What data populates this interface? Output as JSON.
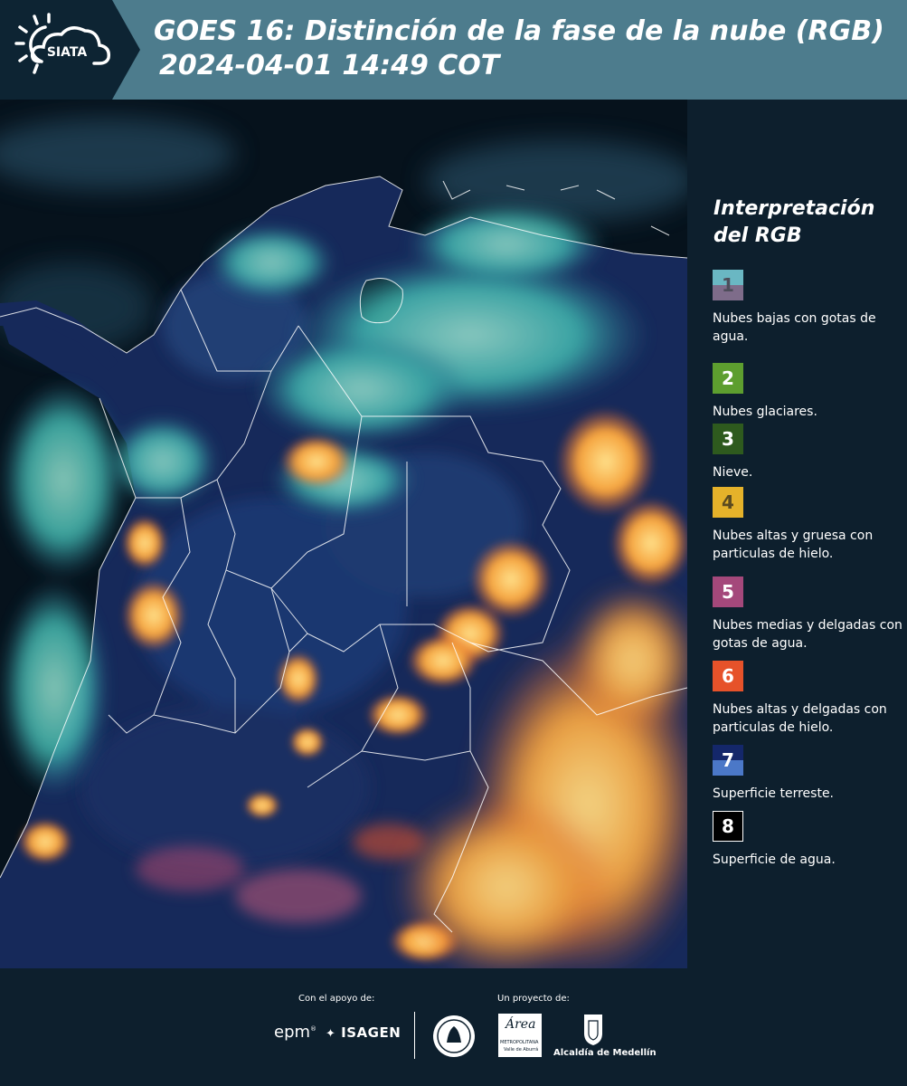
{
  "header": {
    "logo_text": "SIATA",
    "title": "GOES 16: Distinción de la fase de la nube (RGB)",
    "subtitle": "2024-04-01 14:49 COT"
  },
  "legend": {
    "title_line1": "Interpretación",
    "title_line2": "del RGB",
    "items": [
      {
        "number": "1",
        "label": "Nubes bajas con gotas de agua.",
        "color_top": "#6ab7c3",
        "color_bottom": "#7e6c8a",
        "text_color": "#4d4d5a"
      },
      {
        "number": "2",
        "label": "Nubes glaciares.",
        "color_top": "#5d9e2f",
        "color_bottom": "#5d9e2f",
        "text_color": "#ffffff"
      },
      {
        "number": "3",
        "label": "Nieve.",
        "color_top": "#2e5a1e",
        "color_bottom": "#2e5a1e",
        "text_color": "#ffffff"
      },
      {
        "number": "4",
        "label": "Nubes altas y gruesa con particulas de hielo.",
        "color_top": "#e5b22a",
        "color_bottom": "#e5b22a",
        "text_color": "#5a4a20"
      },
      {
        "number": "5",
        "label": "Nubes medias y delgadas con gotas de agua.",
        "color_top": "#a4487b",
        "color_bottom": "#a4487b",
        "text_color": "#ffffff"
      },
      {
        "number": "6",
        "label": "Nubes altas y delgadas con particulas de hielo.",
        "color_top": "#e6522a",
        "color_bottom": "#e6522a",
        "text_color": "#ffffff"
      },
      {
        "number": "7",
        "label": "Superficie terreste.",
        "color_top": "#14276a",
        "color_bottom": "#4b78c8",
        "text_color": "#ffffff"
      },
      {
        "number": "8",
        "label": "Superficie de agua.",
        "color_top": "#000000",
        "color_bottom": "#000000",
        "text_color": "#ffffff"
      }
    ]
  },
  "footer": {
    "support_label": "Con el apoyo de:",
    "project_label": "Un proyecto de:",
    "sponsor1": "epm",
    "sponsor2": "ISAGEN",
    "partner1_line1": "METROPOLITANA",
    "partner1_line2": "Valle de Aburrá",
    "partner1_name": "Área",
    "partner2": "Alcaldía de Medellín"
  },
  "colors": {
    "header_bg": "#4d7c8d",
    "page_bg": "#0d1f2d",
    "cloud_ice_thick": "#f5a23c",
    "cloud_low_water": "#3fb8b0",
    "land": "#16295a",
    "water": "#06121c"
  }
}
